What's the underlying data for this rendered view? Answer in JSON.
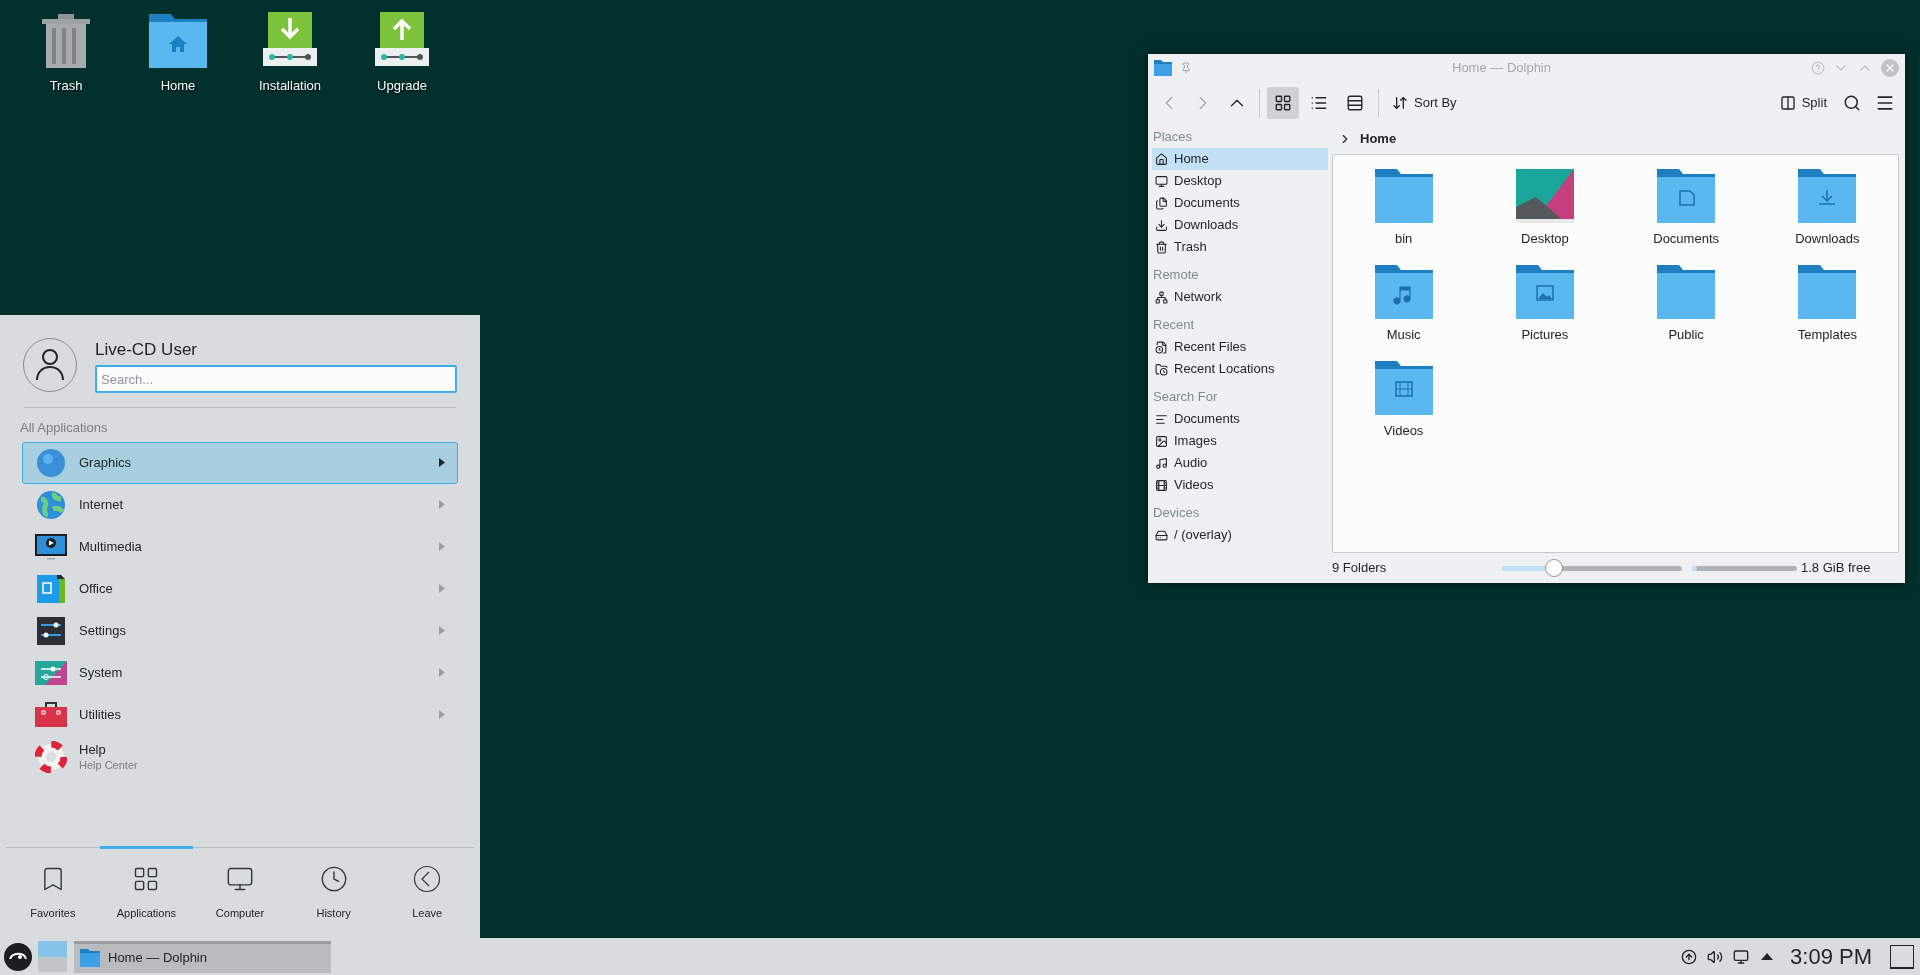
{
  "desktop_icons": [
    {
      "label": "Trash",
      "kind": "trash"
    },
    {
      "label": "Home",
      "kind": "home"
    },
    {
      "label": "Installation",
      "kind": "install"
    },
    {
      "label": "Upgrade",
      "kind": "upgrade"
    }
  ],
  "start_menu": {
    "user_name": "Live-CD User",
    "search": {
      "placeholder": "Search..."
    },
    "section_title": "All Applications",
    "items": [
      {
        "label": "Graphics",
        "kind": "graphics",
        "selected": true,
        "submenu": true
      },
      {
        "label": "Internet",
        "kind": "internet",
        "selected": false,
        "submenu": true
      },
      {
        "label": "Multimedia",
        "kind": "multimedia",
        "selected": false,
        "submenu": true
      },
      {
        "label": "Office",
        "kind": "office",
        "selected": false,
        "submenu": true
      },
      {
        "label": "Settings",
        "kind": "settings",
        "selected": false,
        "submenu": true
      },
      {
        "label": "System",
        "kind": "system",
        "selected": false,
        "submenu": true
      },
      {
        "label": "Utilities",
        "kind": "utilities",
        "selected": false,
        "submenu": true
      },
      {
        "label": "Help",
        "subtitle": "Help Center",
        "kind": "help",
        "selected": false,
        "submenu": false
      }
    ],
    "tabs": [
      {
        "label": "Favorites",
        "kind": "favorites",
        "selected": false
      },
      {
        "label": "Applications",
        "kind": "applications",
        "selected": true
      },
      {
        "label": "Computer",
        "kind": "computer",
        "selected": false
      },
      {
        "label": "History",
        "kind": "history",
        "selected": false
      },
      {
        "label": "Leave",
        "kind": "leave",
        "selected": false
      }
    ]
  },
  "dolphin": {
    "title": "Home — Dolphin",
    "toolbar": {
      "view_modes": [
        {
          "kind": "icons",
          "selected": true
        },
        {
          "kind": "compact",
          "selected": false
        },
        {
          "kind": "details",
          "selected": false
        }
      ],
      "sort_label": "Sort By",
      "split_label": "Split"
    },
    "places": [
      {
        "heading": "Places",
        "items": [
          {
            "label": "Home",
            "kind": "home",
            "selected": true
          },
          {
            "label": "Desktop",
            "kind": "desktop",
            "selected": false
          },
          {
            "label": "Documents",
            "kind": "documents",
            "selected": false
          },
          {
            "label": "Downloads",
            "kind": "downloads",
            "selected": false
          },
          {
            "label": "Trash",
            "kind": "trash",
            "selected": false
          }
        ]
      },
      {
        "heading": "Remote",
        "items": [
          {
            "label": "Network",
            "kind": "network",
            "selected": false
          }
        ]
      },
      {
        "heading": "Recent",
        "items": [
          {
            "label": "Recent Files",
            "kind": "recent-files",
            "selected": false
          },
          {
            "label": "Recent Locations",
            "kind": "recent-locations",
            "selected": false
          }
        ]
      },
      {
        "heading": "Search For",
        "items": [
          {
            "label": "Documents",
            "kind": "text",
            "selected": false
          },
          {
            "label": "Images",
            "kind": "image",
            "selected": false
          },
          {
            "label": "Audio",
            "kind": "audio",
            "selected": false
          },
          {
            "label": "Videos",
            "kind": "video",
            "selected": false
          }
        ]
      },
      {
        "heading": "Devices",
        "items": [
          {
            "label": "/ (overlay)",
            "kind": "drive",
            "selected": false
          }
        ]
      }
    ],
    "breadcrumb": "Home",
    "files": [
      {
        "name": "bin",
        "kind": "folder"
      },
      {
        "name": "Desktop",
        "kind": "desktop"
      },
      {
        "name": "Documents",
        "kind": "documents"
      },
      {
        "name": "Downloads",
        "kind": "downloads"
      },
      {
        "name": "Music",
        "kind": "music"
      },
      {
        "name": "Pictures",
        "kind": "pictures"
      },
      {
        "name": "Public",
        "kind": "folder"
      },
      {
        "name": "Templates",
        "kind": "folder"
      },
      {
        "name": "Videos",
        "kind": "videos"
      }
    ],
    "status": "9 Folders",
    "zoom": {
      "level": 0.29
    },
    "free_space": {
      "level": 0.05,
      "label": "1.8 GiB free"
    }
  },
  "taskbar": {
    "tasks": [
      {
        "label": "Home — Dolphin",
        "selected": true
      }
    ],
    "clock": "3:09 PM"
  }
}
